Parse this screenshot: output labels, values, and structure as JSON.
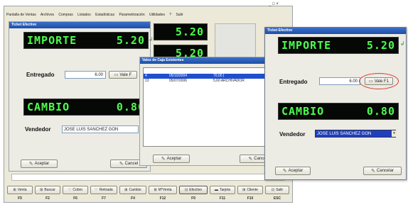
{
  "main_window": {
    "menu": [
      "Pantalla de Ventas",
      "Archivos",
      "Compras",
      "Listados",
      "Estadísticas",
      "Parametrización",
      "Utilidades",
      "?",
      "Salir"
    ],
    "window_controls": [
      "_",
      "□",
      "×"
    ],
    "footer_buttons": [
      {
        "label": "Venta",
        "key": "F5"
      },
      {
        "label": "Buscar",
        "key": "F2"
      },
      {
        "label": "Cobro",
        "key": "F6"
      },
      {
        "label": "Retirada",
        "key": "F7"
      },
      {
        "label": "Cambio",
        "key": "F4"
      },
      {
        "label": "M*Venta",
        "key": "F12"
      },
      {
        "label": "Efectivo",
        "key": "F9"
      },
      {
        "label": "Tarjeta",
        "key": "F11"
      },
      {
        "label": "Cliente",
        "key": "F10"
      },
      {
        "label": "Salir",
        "key": "ESC"
      }
    ],
    "lcd_right_1": "5.20",
    "lcd_right_2": "5.20"
  },
  "ticket_back": {
    "title": "Ticket Efectivo",
    "importe_text": "IMPORTE",
    "importe_value": "5.20",
    "entregado_label": "Entregado",
    "entregado_value": "6.00",
    "vale_button": "Vale F",
    "cambio_text": "CAMBIO",
    "cambio_value": "0.80",
    "vendedor_label": "Vendedor",
    "vendedor_value": "JOSE LUIS SANCHEZ GON",
    "aceptar": "Aceptar",
    "cancelar": "Cancel"
  },
  "vales_dialog": {
    "title": "Vales de Caja Existentes",
    "rows": [
      {
        "num": "4",
        "date": "05/10/2004",
        "desc": "70,00 |"
      },
      {
        "num": "13",
        "date": "05/07/2006",
        "desc": "5,60 ARCHIVADOR"
      }
    ],
    "aceptar": "Aceptar",
    "cancelar": "Cance"
  },
  "ticket_front": {
    "title": "Ticket Efectivo",
    "importe_text": "IMPORTE",
    "importe_value": "5.20",
    "entregado_label": "Entregado",
    "entregado_value": "6.00",
    "vale_button": "Vale F1",
    "cambio_text": "CAMBIO",
    "cambio_value": "0.80",
    "vendedor_label": "Vendedor",
    "vendedor_value": "JOSE LUIS SANCHEZ GON",
    "aceptar": "Aceptar",
    "cancelar": "Cancelar"
  },
  "colors": {
    "lcd_text": "#4dff4d",
    "highlight_circle": "#d63a2f",
    "selection": "#1f4fcf"
  }
}
